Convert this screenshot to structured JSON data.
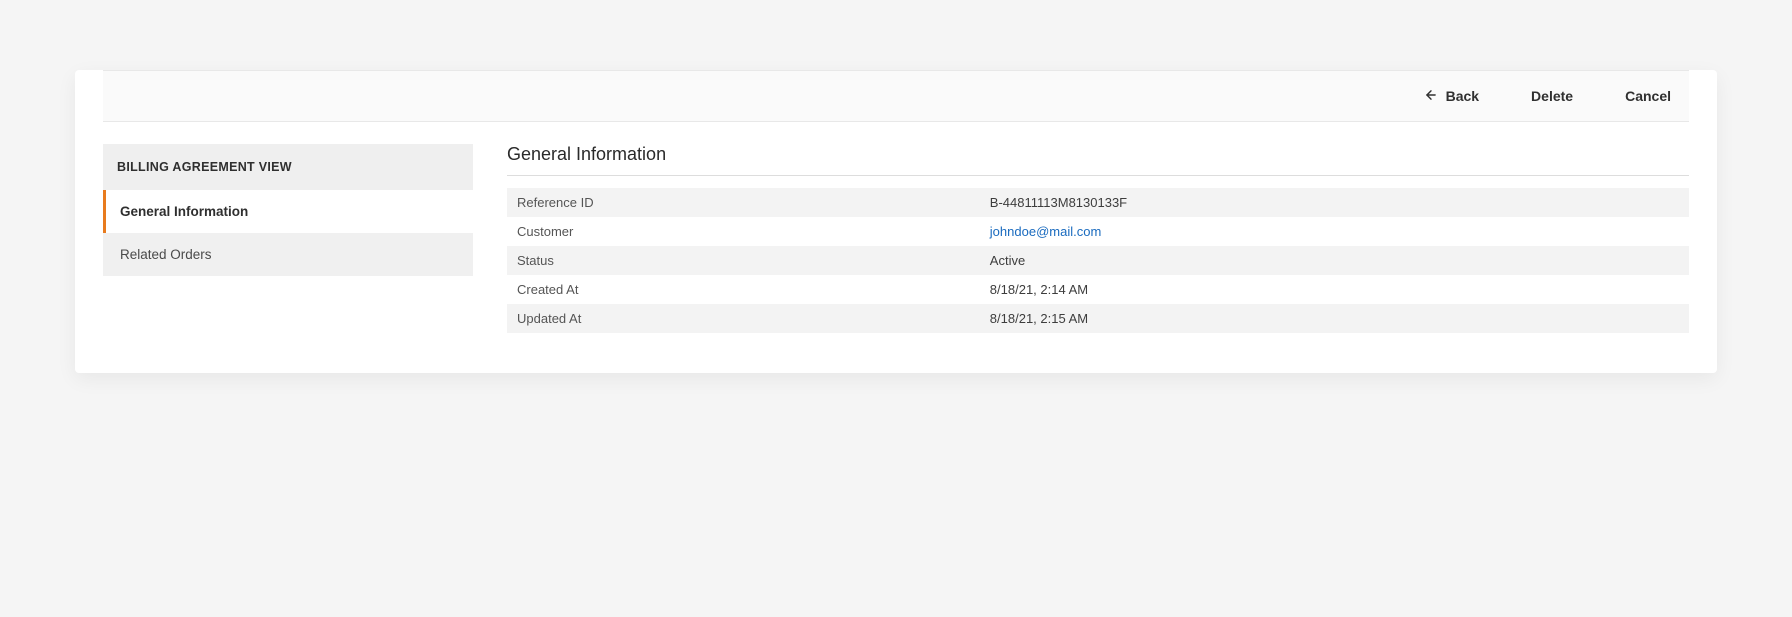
{
  "toolbar": {
    "back_label": "Back",
    "delete_label": "Delete",
    "cancel_label": "Cancel"
  },
  "sidebar": {
    "header": "BILLING AGREEMENT VIEW",
    "items": [
      {
        "label": "General Information",
        "active": true
      },
      {
        "label": "Related Orders",
        "active": false
      }
    ]
  },
  "section": {
    "title": "General Information",
    "rows": [
      {
        "label": "Reference ID",
        "value": "B-44811113M8130133F",
        "link": false
      },
      {
        "label": "Customer",
        "value": "johndoe@mail.com",
        "link": true
      },
      {
        "label": "Status",
        "value": "Active",
        "link": false
      },
      {
        "label": "Created At",
        "value": "8/18/21, 2:14 AM",
        "link": false
      },
      {
        "label": "Updated At",
        "value": "8/18/21, 2:15 AM",
        "link": false
      }
    ]
  }
}
